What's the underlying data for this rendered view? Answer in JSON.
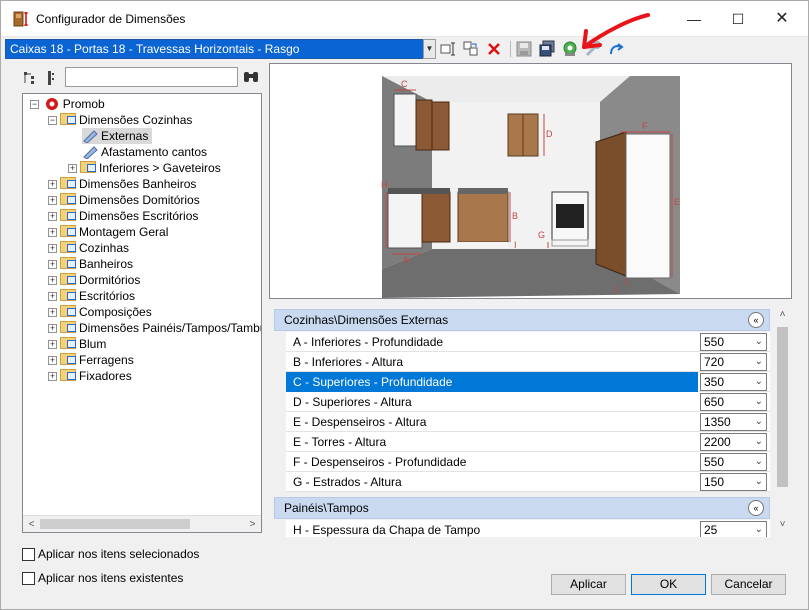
{
  "window": {
    "title": "Configurador de Dimensões",
    "minimize": "—",
    "maximize": "☐",
    "close": "✕"
  },
  "toolbar": {
    "selected_config": "Caixas 18 - Portas 18 - Travessas Horizontais - Rasgo",
    "accent": "#0a64d4",
    "icons": [
      "rename-icon",
      "copy-icon",
      "delete-icon",
      "save-icon",
      "save-as-icon",
      "config-icon",
      "tool-icon",
      "undo-icon"
    ]
  },
  "tree": {
    "root": "Promob",
    "items": [
      {
        "label": "Dimensões Cozinhas",
        "level": 1,
        "expander": "−"
      },
      {
        "label": "Externas",
        "level": 2,
        "expander": ""
      },
      {
        "label": "Afastamento cantos",
        "level": 2,
        "expander": ""
      },
      {
        "label": "Inferiores > Gaveteiros",
        "level": 2,
        "expander": "+"
      },
      {
        "label": "Dimensões Banheiros",
        "level": 1,
        "expander": "+"
      },
      {
        "label": "Dimensões Domitórios",
        "level": 1,
        "expander": "+"
      },
      {
        "label": "Dimensões Escritórios",
        "level": 1,
        "expander": "+"
      },
      {
        "label": "Montagem Geral",
        "level": 1,
        "expander": "+"
      },
      {
        "label": "Cozinhas",
        "level": 1,
        "expander": "+"
      },
      {
        "label": "Banheiros",
        "level": 1,
        "expander": "+"
      },
      {
        "label": "Dormitórios",
        "level": 1,
        "expander": "+"
      },
      {
        "label": "Escritórios",
        "level": 1,
        "expander": "+"
      },
      {
        "label": "Composições",
        "level": 1,
        "expander": "+"
      },
      {
        "label": "Dimensões Painéis/Tampos/Tambura",
        "level": 1,
        "expander": "+"
      },
      {
        "label": "Blum",
        "level": 1,
        "expander": "+"
      },
      {
        "label": "Ferragens",
        "level": 1,
        "expander": "+"
      },
      {
        "label": "Fixadores",
        "level": 1,
        "expander": "+"
      }
    ]
  },
  "preview_labels": [
    "C",
    "D",
    "F",
    "H",
    "B",
    "E",
    "G",
    "I",
    "A",
    "J"
  ],
  "grid": {
    "cat1": "Cozinhas\\Dimensões Externas",
    "rows": [
      {
        "name": "A - Inferiores - Profundidade",
        "value": "550"
      },
      {
        "name": "B - Inferiores - Altura",
        "value": "720"
      },
      {
        "name": "C - Superiores - Profundidade",
        "value": "350"
      },
      {
        "name": "D - Superiores - Altura",
        "value": "650"
      },
      {
        "name": "E - Despenseiros - Altura",
        "value": "1350"
      },
      {
        "name": "E - Torres - Altura",
        "value": "2200"
      },
      {
        "name": "F - Despenseiros - Profundidade",
        "value": "550"
      },
      {
        "name": "G - Estrados - Altura",
        "value": "150"
      }
    ],
    "cat2": "Painéis\\Tampos",
    "rows2": [
      {
        "name": "H - Espessura da Chapa de Tampo",
        "value": "25"
      }
    ],
    "collapse_glyph": "«"
  },
  "checks": {
    "apply_selected": "Aplicar nos itens selecionados",
    "apply_existing": "Aplicar nos itens existentes"
  },
  "buttons": {
    "apply": "Aplicar",
    "ok": "OK",
    "cancel": "Cancelar"
  }
}
